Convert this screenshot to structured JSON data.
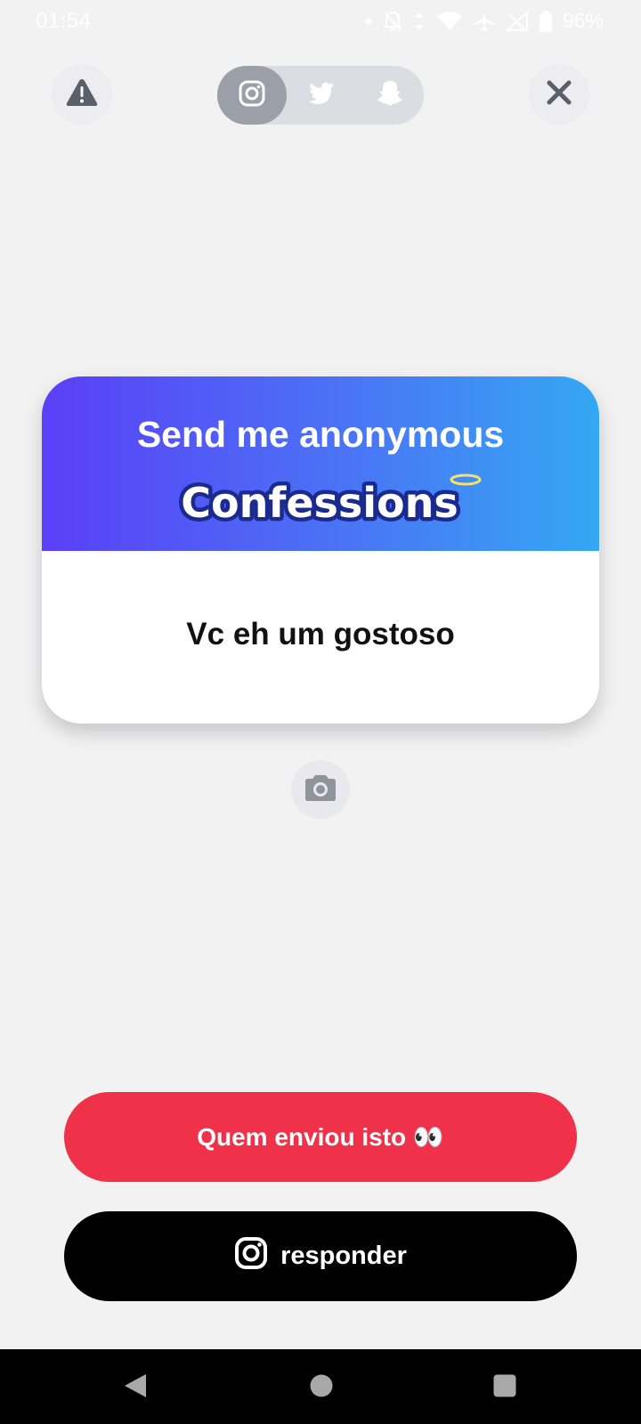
{
  "status_bar": {
    "time": "01:54",
    "battery": "96%",
    "icons": [
      "dot-icon",
      "bell-off-icon",
      "data-arrows-icon",
      "wifi-icon",
      "airplane-icon",
      "signal-off-icon",
      "battery-icon"
    ]
  },
  "top_controls": {
    "report_icon": "warning-icon",
    "close_icon": "close-icon",
    "platforms": [
      {
        "name": "instagram",
        "icon": "instagram-icon",
        "active": true
      },
      {
        "name": "twitter",
        "icon": "twitter-icon",
        "active": false
      },
      {
        "name": "snapchat",
        "icon": "snapchat-icon",
        "active": false
      }
    ]
  },
  "card": {
    "headline": "Send me anonymous",
    "logo_text": "Confessions",
    "message": "Vc eh um gostoso",
    "gradient": [
      "#5a3ff6",
      "#4a74f5",
      "#34a8f2"
    ]
  },
  "camera": {
    "icon": "camera-icon"
  },
  "actions": {
    "who_sent_label": "Quem enviou isto 👀",
    "reply_label": "responder",
    "reply_icon": "instagram-icon"
  },
  "colors": {
    "background": "#f2f2f3",
    "who_sent_bg": "#ef3149",
    "reply_bg": "#000000",
    "nav_bg": "#000000"
  },
  "nav_bar": {
    "items": [
      "back-icon",
      "home-icon",
      "recents-icon"
    ]
  }
}
